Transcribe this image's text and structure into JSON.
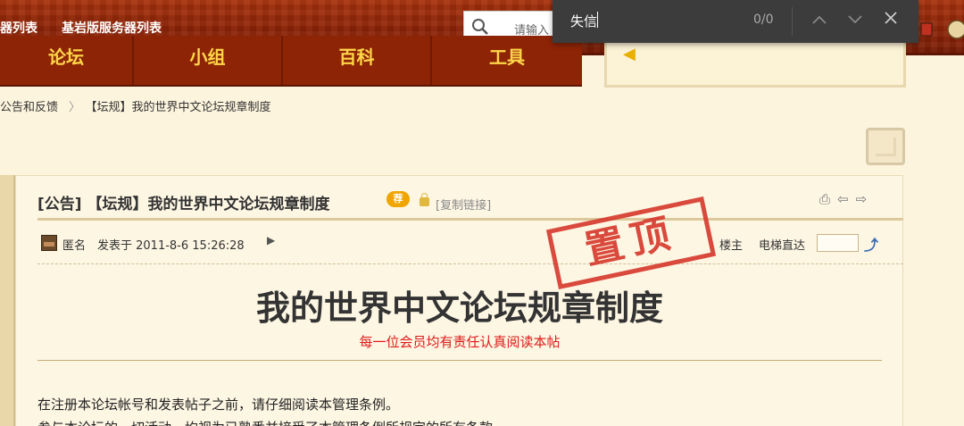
{
  "topbar": {
    "links": [
      "器列表",
      "基岩版服务器列表"
    ],
    "search_placeholder": "请输入"
  },
  "nav": {
    "tabs": [
      "论坛",
      "小组",
      "百科",
      "工具"
    ]
  },
  "findbar": {
    "query": "失信",
    "count": "0/0"
  },
  "breadcrumb": {
    "items": [
      "公告和反馈",
      "【坛规】我的世界中文论坛规章制度"
    ],
    "separator": "〉"
  },
  "post": {
    "title": "[公告] 【坛规】我的世界中文论坛规章制度",
    "recommend_badge": "荐",
    "copy_link": "[复制链接]",
    "author": "匿名",
    "date": "发表于 2011-8-6 15:26:28",
    "floor_owner": "楼主",
    "jump_label": "电梯直达",
    "stamp": "置顶",
    "heading": "我的世界中文论坛规章制度",
    "subheading": "每一位会员均有责任认真阅读本帖",
    "body": [
      "在注册本论坛帐号和发表帖子之前，请仔细阅读本管理条例。",
      "参与本论坛的一切活动，均视为已熟悉并接受了本管理条例所规定的所有条款。"
    ]
  },
  "colors": {
    "topbar": "#8f2407",
    "nav_text": "#ffd64a",
    "stamp": "#d6382c",
    "subtitle": "#dd1a1a",
    "page_bg": "#fdf4dd"
  }
}
